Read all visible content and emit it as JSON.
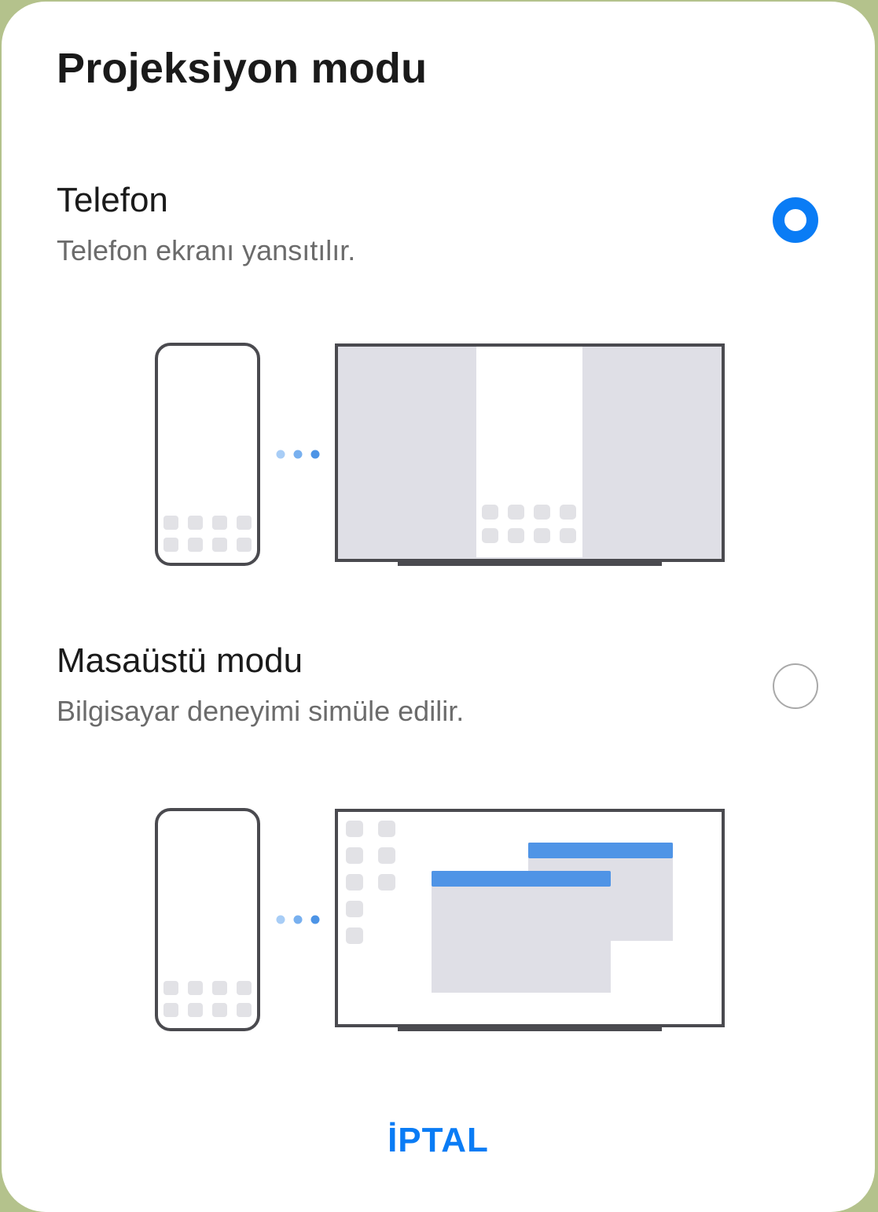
{
  "dialog": {
    "title": "Projeksiyon modu",
    "options": [
      {
        "title": "Telefon",
        "subtitle": "Telefon ekranı yansıtılır.",
        "selected": true
      },
      {
        "title": "Masaüstü modu",
        "subtitle": "Bilgisayar deneyimi simüle edilir.",
        "selected": false
      }
    ],
    "cancel_label": "İPTAL"
  },
  "colors": {
    "accent": "#0a7cf5",
    "window_titlebar": "#4f94e6",
    "device_outline": "#4a4a4f",
    "panel_fill": "#dfdfe6"
  }
}
